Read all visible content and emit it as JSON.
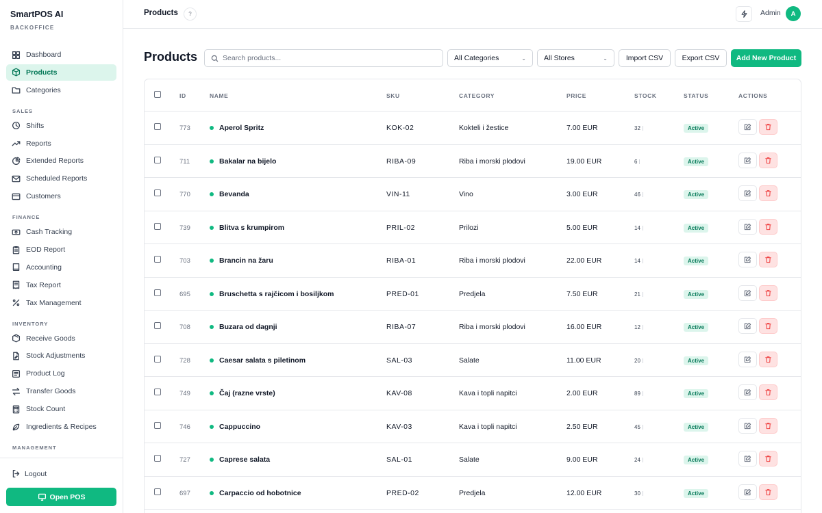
{
  "app": {
    "name": "SmartPOS AI",
    "subtitle": "BACKOFFICE"
  },
  "sidebar": {
    "items": [
      {
        "label": "Dashboard",
        "icon": "dashboard-icon"
      },
      {
        "label": "Products",
        "icon": "cube-icon",
        "active": true
      },
      {
        "label": "Categories",
        "icon": "folder-icon"
      }
    ],
    "sections": [
      {
        "label": "SALES",
        "items": [
          {
            "label": "Shifts",
            "icon": "clock-icon"
          },
          {
            "label": "Reports",
            "icon": "trend-icon"
          },
          {
            "label": "Extended Reports",
            "icon": "pie-icon"
          },
          {
            "label": "Scheduled Reports",
            "icon": "mail-icon"
          },
          {
            "label": "Customers",
            "icon": "card-icon"
          }
        ]
      },
      {
        "label": "FINANCE",
        "items": [
          {
            "label": "Cash Tracking",
            "icon": "cash-icon"
          },
          {
            "label": "EOD Report",
            "icon": "clipboard-icon"
          },
          {
            "label": "Accounting",
            "icon": "book-icon"
          },
          {
            "label": "Tax Report",
            "icon": "receipt-icon"
          },
          {
            "label": "Tax Management",
            "icon": "percent-icon"
          }
        ]
      },
      {
        "label": "INVENTORY",
        "items": [
          {
            "label": "Receive Goods",
            "icon": "package-icon"
          },
          {
            "label": "Stock Adjustments",
            "icon": "file-edit-icon"
          },
          {
            "label": "Product Log",
            "icon": "list-icon"
          },
          {
            "label": "Transfer Goods",
            "icon": "transfer-icon"
          },
          {
            "label": "Stock Count",
            "icon": "calculator-icon"
          },
          {
            "label": "Ingredients & Recipes",
            "icon": "leaf-icon"
          }
        ]
      },
      {
        "label": "MANAGEMENT",
        "items": []
      }
    ],
    "logout": "Logout",
    "open_pos": "Open POS"
  },
  "topbar": {
    "title": "Products",
    "help": "?",
    "user": "Admin",
    "avatar": "A"
  },
  "page": {
    "title": "Products",
    "search_placeholder": "Search products...",
    "category_filter": "All Categories",
    "store_filter": "All Stores",
    "import_label": "Import CSV",
    "export_label": "Export CSV",
    "add_label": "Add New Product"
  },
  "table": {
    "columns": [
      "ID",
      "NAME",
      "SKU",
      "CATEGORY",
      "PRICE",
      "STOCK",
      "STATUS",
      "ACTIONS"
    ],
    "rows": [
      {
        "id": "773",
        "name": "Aperol Spritz",
        "sku": "KOK-02",
        "category": "Kokteli i žestice",
        "price": "7.00 EUR",
        "stock": "32",
        "status": "Active"
      },
      {
        "id": "711",
        "name": "Bakalar na bijelo",
        "sku": "RIBA-09",
        "category": "Riba i morski plodovi",
        "price": "19.00 EUR",
        "stock": "6",
        "status": "Active"
      },
      {
        "id": "770",
        "name": "Bevanda",
        "sku": "VIN-11",
        "category": "Vino",
        "price": "3.00 EUR",
        "stock": "46",
        "status": "Active"
      },
      {
        "id": "739",
        "name": "Blitva s krumpirom",
        "sku": "PRIL-02",
        "category": "Prilozi",
        "price": "5.00 EUR",
        "stock": "14",
        "status": "Active"
      },
      {
        "id": "703",
        "name": "Brancin na žaru",
        "sku": "RIBA-01",
        "category": "Riba i morski plodovi",
        "price": "22.00 EUR",
        "stock": "14",
        "status": "Active"
      },
      {
        "id": "695",
        "name": "Bruschetta s rajčicom i bosiljkom",
        "sku": "PRED-01",
        "category": "Predjela",
        "price": "7.50 EUR",
        "stock": "21",
        "status": "Active"
      },
      {
        "id": "708",
        "name": "Buzara od dagnji",
        "sku": "RIBA-07",
        "category": "Riba i morski plodovi",
        "price": "16.00 EUR",
        "stock": "12",
        "status": "Active"
      },
      {
        "id": "728",
        "name": "Caesar salata s piletinom",
        "sku": "SAL-03",
        "category": "Salate",
        "price": "11.00 EUR",
        "stock": "20",
        "status": "Active"
      },
      {
        "id": "749",
        "name": "Čaj (razne vrste)",
        "sku": "KAV-08",
        "category": "Kava i topli napitci",
        "price": "2.00 EUR",
        "stock": "89",
        "status": "Active"
      },
      {
        "id": "746",
        "name": "Cappuccino",
        "sku": "KAV-03",
        "category": "Kava i topli napitci",
        "price": "2.50 EUR",
        "stock": "45",
        "status": "Active"
      },
      {
        "id": "727",
        "name": "Caprese salata",
        "sku": "SAL-01",
        "category": "Salate",
        "price": "9.00 EUR",
        "stock": "24",
        "status": "Active"
      },
      {
        "id": "697",
        "name": "Carpaccio od hobotnice",
        "sku": "PRED-02",
        "category": "Predjela",
        "price": "12.00 EUR",
        "stock": "30",
        "status": "Active"
      }
    ]
  },
  "colors": {
    "accent": "#10b981",
    "accent_soft": "#dcf5ec",
    "danger_soft": "#fee2e2",
    "danger": "#ef4444"
  }
}
